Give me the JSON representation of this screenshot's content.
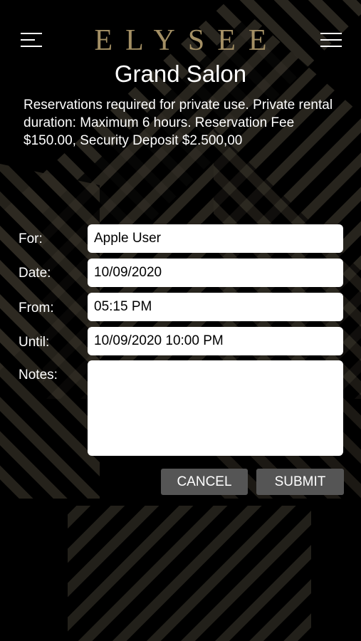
{
  "brand": {
    "logo_text": "ELYSEE",
    "accent_color": "#a38f64"
  },
  "header": {
    "left_icon": "hamburger-menu-icon",
    "right_icon": "list-menu-icon",
    "title": "Grand Salon"
  },
  "info": {
    "description": "Reservations required for private use. Private rental duration: Maximum 6 hours. Reservation Fee $150.00, Security Deposit $2.500,00"
  },
  "form": {
    "for_label": "For:",
    "for_value": "Apple User",
    "date_label": "Date:",
    "date_value": "10/09/2020",
    "from_label": "From:",
    "from_value": "05:15 PM",
    "until_label": "Until:",
    "until_value": "10/09/2020 10:00 PM",
    "notes_label": "Notes:",
    "notes_value": ""
  },
  "actions": {
    "cancel_label": "CANCEL",
    "submit_label": "SUBMIT"
  }
}
